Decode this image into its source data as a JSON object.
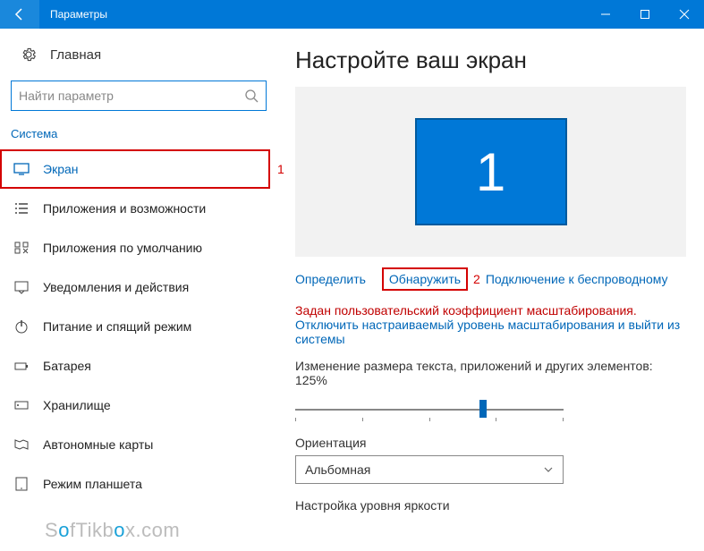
{
  "titlebar": {
    "title": "Параметры"
  },
  "sidebar": {
    "home_label": "Главная",
    "search_placeholder": "Найти параметр",
    "category": "Система",
    "items": [
      {
        "label": "Экран"
      },
      {
        "label": "Приложения и возможности"
      },
      {
        "label": "Приложения по умолчанию"
      },
      {
        "label": "Уведомления и действия"
      },
      {
        "label": "Питание и спящий режим"
      },
      {
        "label": "Батарея"
      },
      {
        "label": "Хранилище"
      },
      {
        "label": "Автономные карты"
      },
      {
        "label": "Режим планшета"
      }
    ]
  },
  "main": {
    "heading": "Настройте ваш экран",
    "monitor_id": "1",
    "links": {
      "identify": "Определить",
      "detect": "Обнаружить",
      "wireless": "Подключение к беспроводному"
    },
    "warning": "Задан пользовательский коэффициент масштабирования.",
    "disable_link": "Отключить настраиваемый уровень масштабирования и выйти из системы",
    "scale_label": "Изменение размера текста, приложений и других элементов: 125%",
    "orientation_label": "Ориентация",
    "orientation_value": "Альбомная",
    "brightness_label": "Настройка уровня яркости"
  },
  "annotations": {
    "n1": "1",
    "n2": "2"
  },
  "watermark": {
    "pre": "S",
    "o1": "o",
    "mid": "fTikb",
    "o2": "o",
    "post": "x.com"
  }
}
